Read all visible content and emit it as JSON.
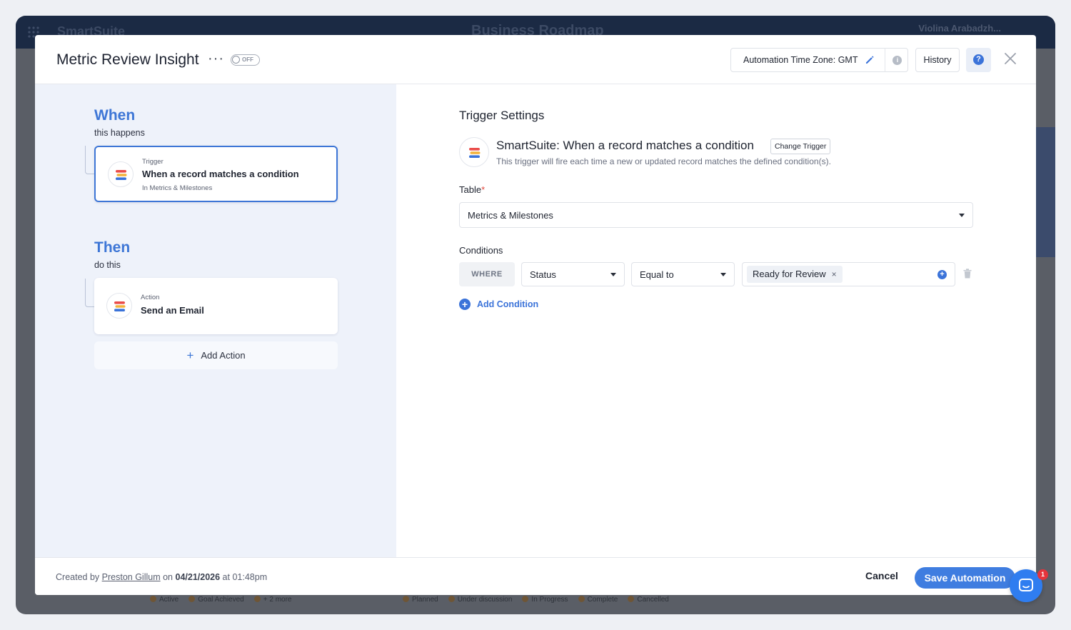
{
  "background": {
    "app_name": "SmartSuite",
    "board_title": "Business Roadmap",
    "user_name": "Violina Arabadzh...",
    "legend_left": [
      "Active",
      "Goal Achieved",
      "+ 2 more"
    ],
    "legend_right": [
      "Planned",
      "Under discussion",
      "In Progress",
      "Complete",
      "Cancelled"
    ]
  },
  "header": {
    "title": "Metric Review Insight",
    "more_label": "···",
    "toggle_label": "OFF",
    "toggle_on": false,
    "timezone_label": "Automation Time Zone: GMT",
    "info_label": "i",
    "history_label": "History",
    "help_label": "?"
  },
  "when": {
    "title": "When",
    "subtitle": "this happens",
    "card": {
      "kind": "Trigger",
      "name": "When a record matches a condition",
      "meta": "In Metrics & Milestones"
    }
  },
  "then": {
    "title": "Then",
    "subtitle": "do this",
    "card": {
      "kind": "Action",
      "name": "Send an Email"
    },
    "add_action_label": "Add Action",
    "add_action_icon": "+"
  },
  "trigger_settings": {
    "title": "Trigger Settings",
    "trigger_name": "SmartSuite: When a record matches a condition",
    "change_trigger_label": "Change Trigger",
    "description": "This trigger will fire each time a new or updated record matches the defined condition(s).",
    "table_label": "Table",
    "required_mark": "*",
    "table_value": "Metrics & Milestones",
    "conditions_label": "Conditions",
    "condition": {
      "where_label": "WHERE",
      "field": "Status",
      "operator": "Equal to",
      "value": "Ready for Review",
      "remove_label": "×",
      "add_value_label": "+"
    },
    "add_condition_label": "Add Condition",
    "add_condition_icon": "+"
  },
  "footer": {
    "created_prefix": "Created by",
    "creator": "Preston Gillum",
    "on_word": "on",
    "date": "04/21/2026",
    "at_word": "at",
    "time": "01:48pm",
    "cancel_label": "Cancel",
    "save_label": "Save Automation"
  },
  "chat": {
    "badge_count": "1"
  },
  "colors": {
    "accent": "#3d76d6",
    "primary_button": "#3f7de0",
    "left_pane_bg": "#eef2fa",
    "badge": "#e5343c"
  }
}
